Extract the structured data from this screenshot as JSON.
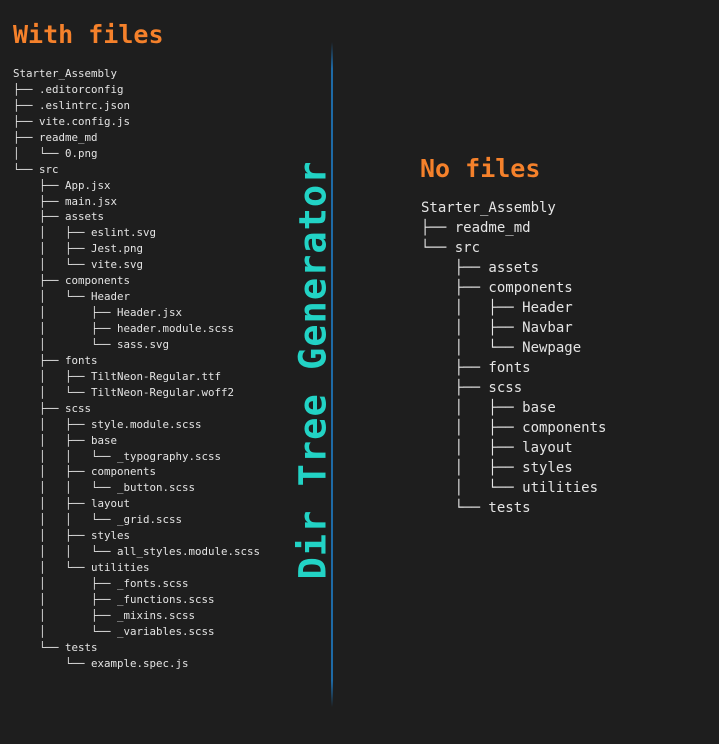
{
  "left_panel": {
    "heading": "With files",
    "tree_lines": [
      "Starter_Assembly",
      "├── .editorconfig",
      "├── .eslintrc.json",
      "├── vite.config.js",
      "├── readme_md",
      "│   └── 0.png",
      "└── src",
      "    ├── App.jsx",
      "    ├── main.jsx",
      "    ├── assets",
      "    │   ├── eslint.svg",
      "    │   ├── Jest.png",
      "    │   └── vite.svg",
      "    ├── components",
      "    │   └── Header",
      "    │       ├── Header.jsx",
      "    │       ├── header.module.scss",
      "    │       └── sass.svg",
      "    ├── fonts",
      "    │   ├── TiltNeon-Regular.ttf",
      "    │   └── TiltNeon-Regular.woff2",
      "    ├── scss",
      "    │   ├── style.module.scss",
      "    │   ├── base",
      "    │   │   └── _typography.scss",
      "    │   ├── components",
      "    │   │   └── _button.scss",
      "    │   ├── layout",
      "    │   │   └── _grid.scss",
      "    │   ├── styles",
      "    │   │   └── all_styles.module.scss",
      "    │   └── utilities",
      "    │       ├── _fonts.scss",
      "    │       ├── _functions.scss",
      "    │       ├── _mixins.scss",
      "    │       └── _variables.scss",
      "    └── tests",
      "        └── example.spec.js"
    ]
  },
  "center": {
    "title": "Dir Tree Generator"
  },
  "right_panel": {
    "heading": "No files",
    "tree_lines": [
      "Starter_Assembly",
      "├── readme_md",
      "└── src",
      "    ├── assets",
      "    ├── components",
      "    │   ├── Header",
      "    │   ├── Navbar",
      "    │   └── Newpage",
      "    ├── fonts",
      "    ├── scss",
      "    │   ├── base",
      "    │   ├── components",
      "    │   ├── layout",
      "    │   ├── styles",
      "    │   └── utilities",
      "    └── tests"
    ]
  },
  "colors": {
    "background": "#1e1e1e",
    "heading": "#f5812b",
    "title": "#22d3c5",
    "divider": "#1e6aa6",
    "tree_text": "#e4e4e4"
  }
}
